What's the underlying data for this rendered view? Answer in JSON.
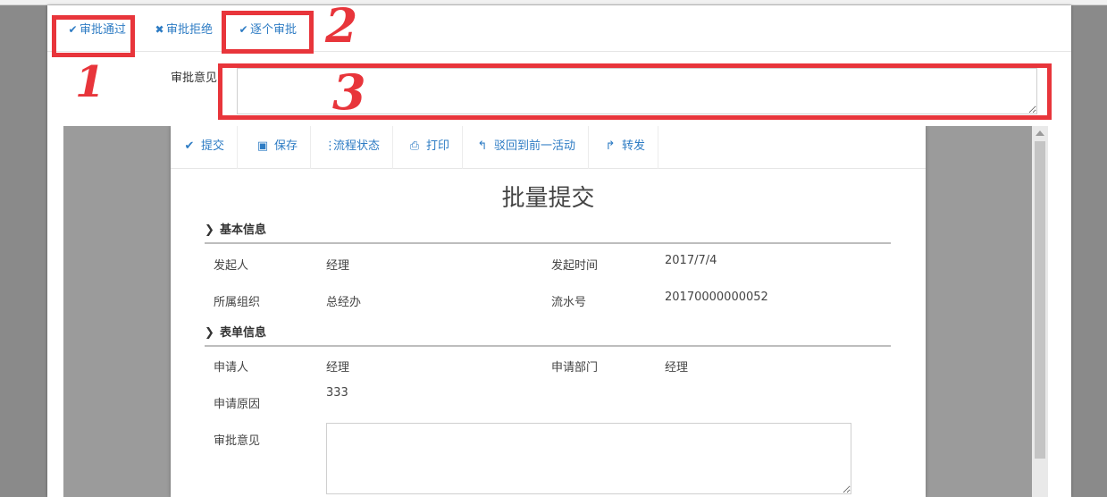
{
  "toolbar": {
    "approve_label": "审批通过",
    "reject_label": "审批拒绝",
    "one_by_one_label": "逐个审批"
  },
  "opinion": {
    "label": "审批意见",
    "value": ""
  },
  "form": {
    "toolbar": {
      "submit": "提交",
      "save": "保存",
      "flow_status": "流程状态",
      "print": "打印",
      "reject_prev": "驳回到前一活动",
      "forward": "转发"
    },
    "title": "批量提交",
    "basic_section": {
      "title": "基本信息",
      "initiator_label": "发起人",
      "initiator_value": "经理",
      "start_time_label": "发起时间",
      "start_time_value": "2017/7/4",
      "org_label": "所属组织",
      "org_value": "总经办",
      "serial_label": "流水号",
      "serial_value": "20170000000052"
    },
    "form_section": {
      "title": "表单信息",
      "applicant_label": "申请人",
      "applicant_value": "经理",
      "dept_label": "申请部门",
      "dept_value": "经理",
      "reason_label": "申请原因",
      "reason_value": "333",
      "opinion_label": "审批意见"
    }
  },
  "annotations": {
    "num1": "1",
    "num2": "2",
    "num3": "3"
  },
  "colors": {
    "accent": "#2e7cc4",
    "annotation": "#e8353b"
  }
}
